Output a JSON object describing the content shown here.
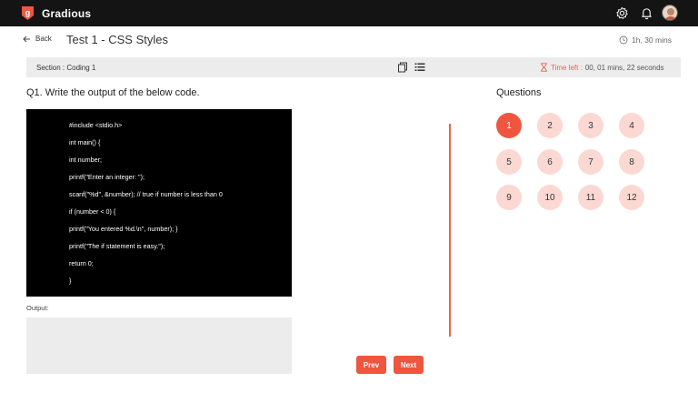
{
  "app": {
    "brand": "Gradious"
  },
  "colors": {
    "accent": "#f0553f",
    "accent_light": "#fcd8d2",
    "topbar": "#141414"
  },
  "icons": {
    "settings": "gear-icon",
    "notifications": "bell-icon",
    "back": "arrow-left-icon",
    "duration": "clock-icon",
    "timer": "hourglass-icon",
    "copy": "copy-icon",
    "list": "list-icon"
  },
  "header": {
    "back_label": "Back",
    "title": "Test 1 - CSS Styles",
    "duration": "1h, 30 mins"
  },
  "section": {
    "label": "Section : Coding 1",
    "time_left_label": "Time left :",
    "time_left_value": "00, 01 mins, 22 seconds"
  },
  "question": {
    "text": "Q1. Write the output of the below code.",
    "code_lines": [
      "#include <stdio.h>",
      "int main() {",
      "int number;",
      "printf(\"Enter an integer: \");",
      "scanf(\"%d\", &number); // true if number is less than 0",
      "if (number < 0) {",
      "printf(\"You entered %d.\\n\", number); }",
      "printf(\"The if statement is easy.\");",
      "return 0;",
      "}"
    ],
    "output_label": "Output:"
  },
  "nav": {
    "prev_label": "Prev",
    "next_label": "Next"
  },
  "questions_panel": {
    "title": "Questions",
    "numbers": [
      "1",
      "2",
      "3",
      "4",
      "5",
      "6",
      "7",
      "8",
      "9",
      "10",
      "11",
      "12"
    ],
    "active_index": 0
  }
}
